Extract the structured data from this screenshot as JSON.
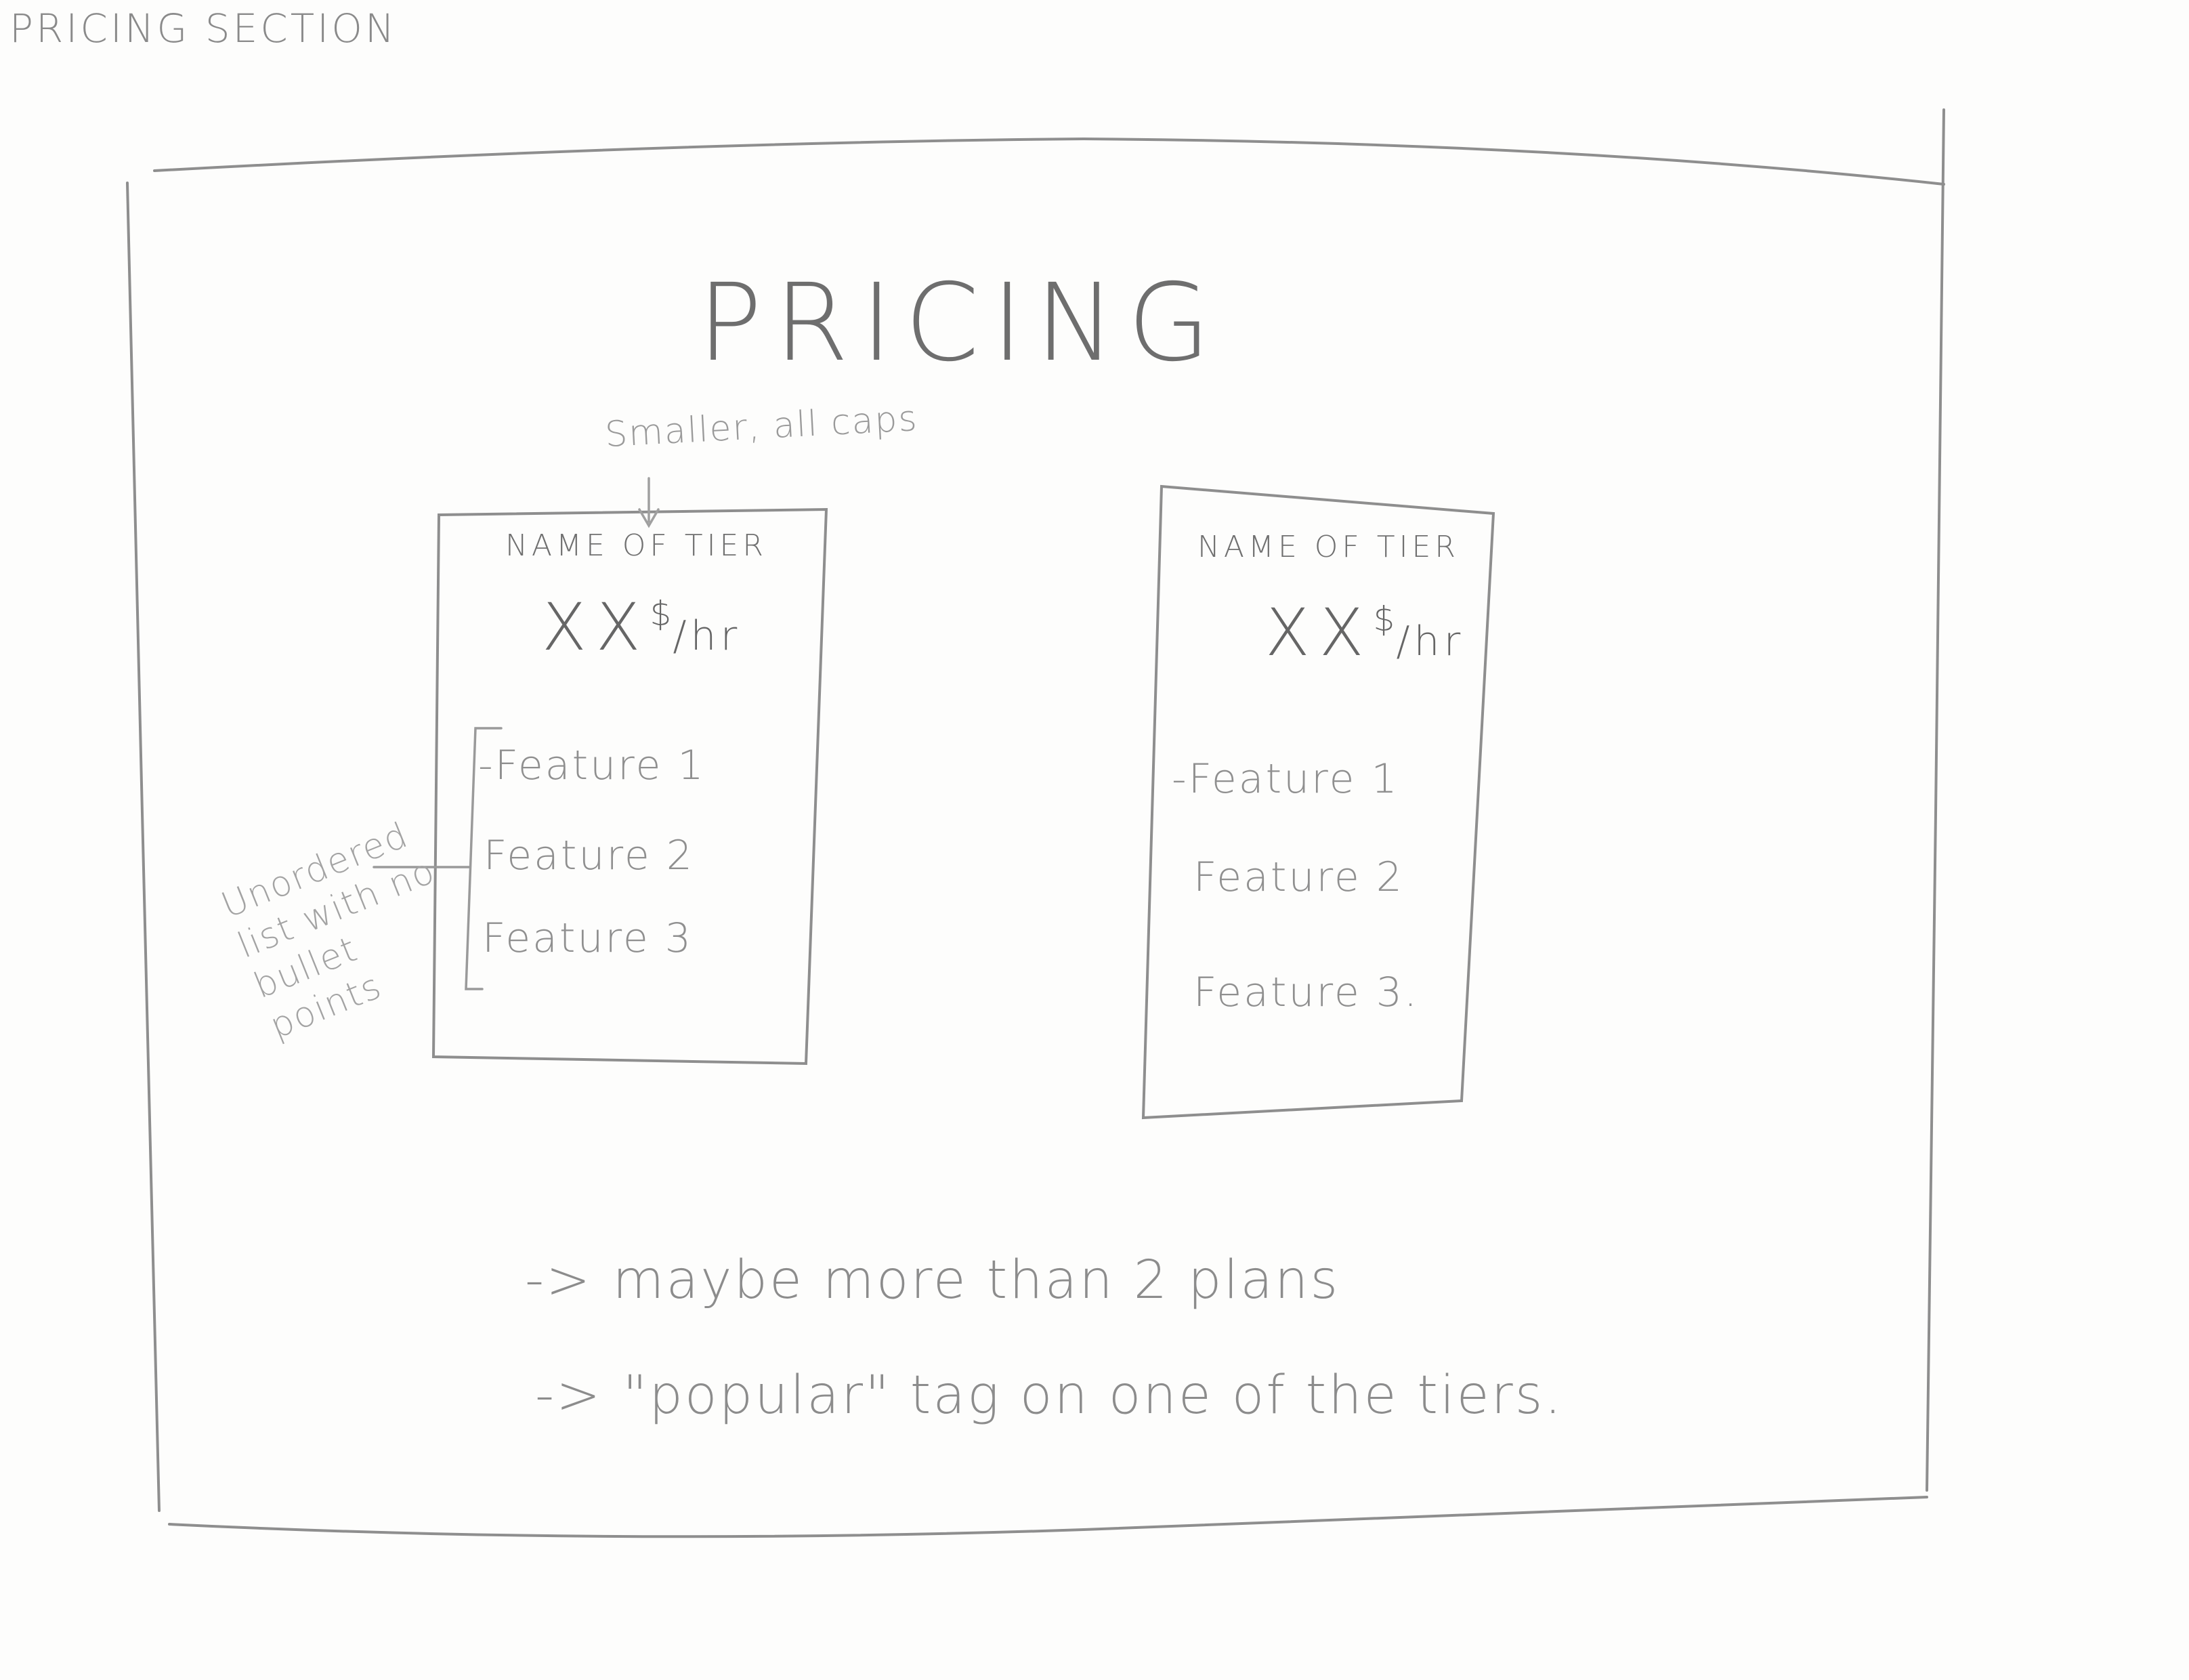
{
  "sketch_title": "PRICING SECTION",
  "heading": "PRICING",
  "heading_note": "Smaller, all caps",
  "tiers": [
    {
      "name": "NAME OF TIER",
      "amount": "XX",
      "currency": "$",
      "unit": "/hr",
      "features": [
        "-Feature 1",
        "Feature 2",
        "Feature 3"
      ]
    },
    {
      "name": "NAME OF TIER",
      "amount": "XX",
      "currency": "$",
      "unit": "/hr",
      "features": [
        "-Feature 1",
        "Feature 2",
        "Feature 3."
      ]
    }
  ],
  "list_note": "Unordered list with no bullet points",
  "notes": [
    "maybe more than 2 plans",
    "\"popular\" tag on one of the tiers."
  ],
  "arrow_glyph": "->"
}
